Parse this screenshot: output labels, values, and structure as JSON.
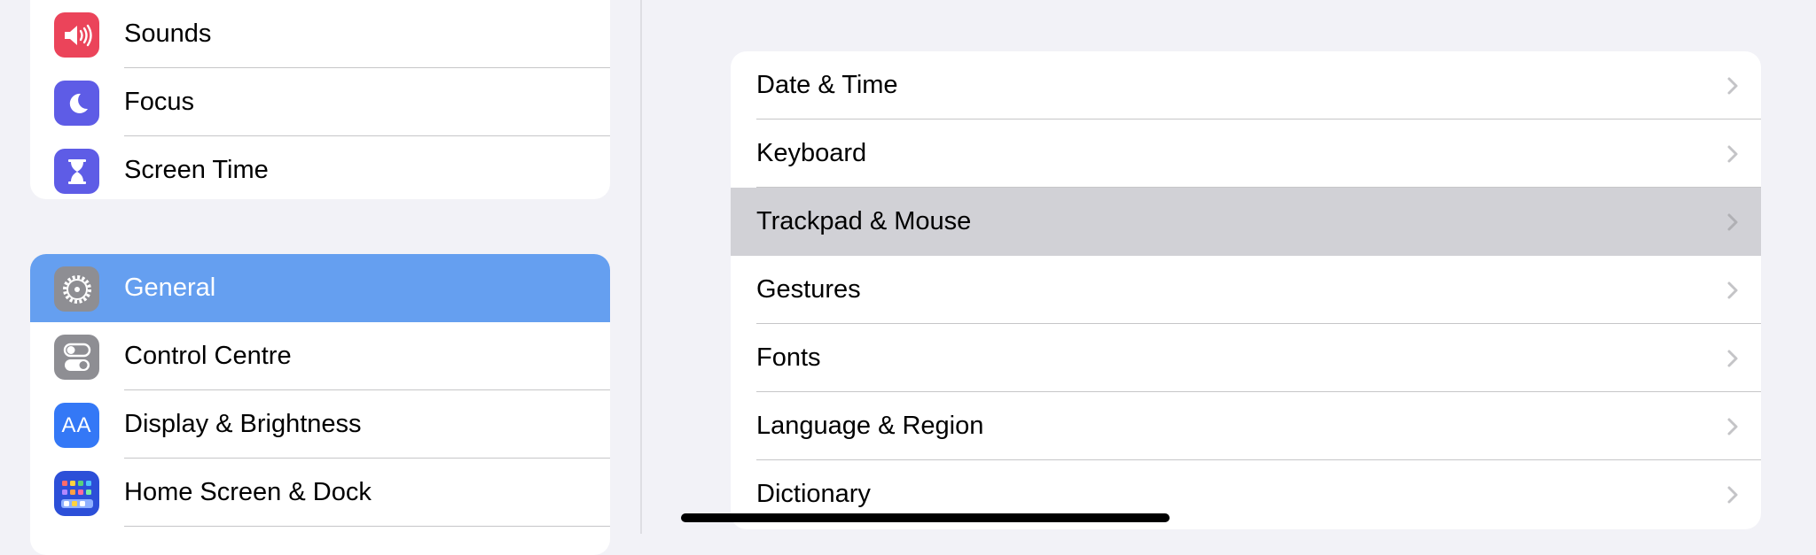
{
  "sidebar": {
    "group_top": [
      {
        "label": "Sounds",
        "icon": "speaker-icon",
        "color": "#eb445a"
      },
      {
        "label": "Focus",
        "icon": "moon-icon",
        "color": "#5e5ce6"
      },
      {
        "label": "Screen Time",
        "icon": "hourglass-icon",
        "color": "#5e5ce6"
      }
    ],
    "group_main": [
      {
        "label": "General",
        "icon": "gear-icon",
        "color": "#8e8e93",
        "selected": true
      },
      {
        "label": "Control Centre",
        "icon": "toggles-icon",
        "color": "#8e8e93"
      },
      {
        "label": "Display & Brightness",
        "icon": "text-size-icon",
        "color": "#3478f6",
        "icon_text": "AA"
      },
      {
        "label": "Home Screen & Dock",
        "icon": "app-grid-icon",
        "color": "#2c4fd8"
      }
    ],
    "selected_color": "#659ff0"
  },
  "detail": {
    "items": [
      {
        "label": "Date & Time"
      },
      {
        "label": "Keyboard"
      },
      {
        "label": "Trackpad & Mouse",
        "highlighted": true
      },
      {
        "label": "Gestures"
      },
      {
        "label": "Fonts"
      },
      {
        "label": "Language & Region"
      },
      {
        "label": "Dictionary"
      }
    ]
  }
}
